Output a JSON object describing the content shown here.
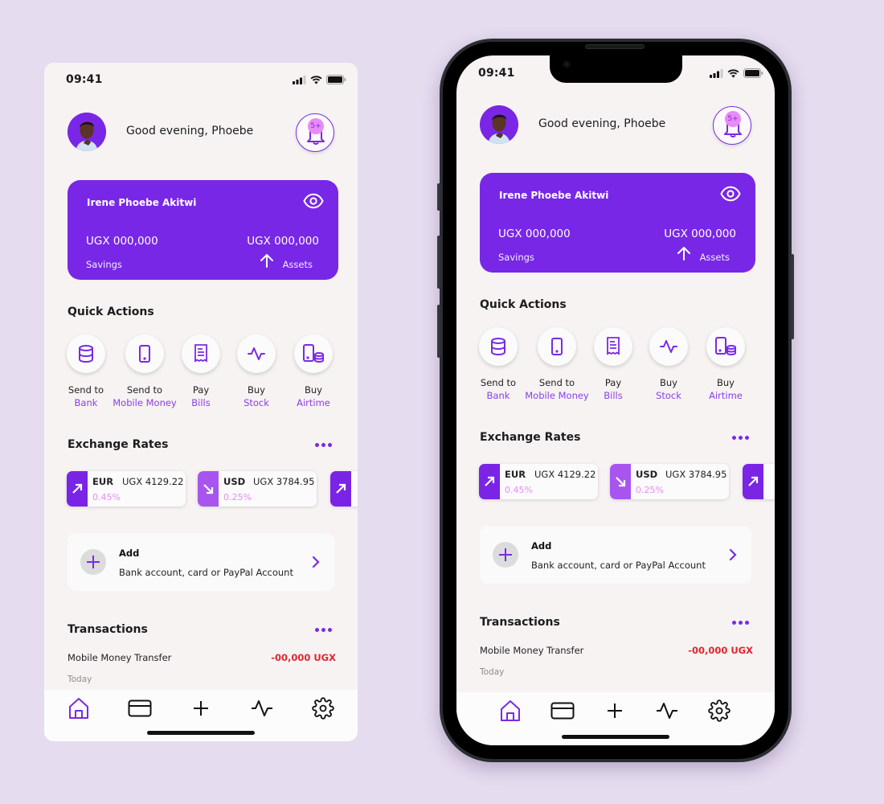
{
  "status_bar": {
    "time": "09:41",
    "icons": [
      "cellular-signal-icon",
      "wifi-icon",
      "battery-icon"
    ]
  },
  "header": {
    "greeting": "Good evening, Phoebe",
    "avatar": "user-avatar",
    "notification_badge": "5+"
  },
  "balance_card": {
    "holder_name": "Irene Phoebe Akitwi",
    "savings_amount": "UGX 000,000",
    "savings_label": "Savings",
    "assets_amount": "UGX 000,000",
    "assets_label": "Assets",
    "icons": [
      "eye-icon",
      "arrow-up-icon"
    ]
  },
  "quick_actions": {
    "title": "Quick Actions",
    "items": [
      {
        "line1": "Send to",
        "line2": "Bank",
        "icon": "database-icon"
      },
      {
        "line1": "Send to",
        "line2": "Mobile Money",
        "icon": "mobile-phone-icon"
      },
      {
        "line1": "Pay",
        "line2": "Bills",
        "icon": "receipt-icon"
      },
      {
        "line1": "Buy",
        "line2": "Stock",
        "icon": "activity-icon"
      },
      {
        "line1": "Buy",
        "line2": "Airtime",
        "icon": "phone-coins-icon"
      }
    ]
  },
  "exchange_rates": {
    "title": "Exchange Rates",
    "items": [
      {
        "code": "EUR",
        "rate": "UGX 4129.22",
        "change": "0.45%",
        "trend": "up",
        "color": "#7a24e6"
      },
      {
        "code": "USD",
        "rate": "UGX 3784.95",
        "change": "0.25%",
        "trend": "down",
        "color": "#a855f0"
      },
      {
        "code": "",
        "rate": "",
        "change": "",
        "trend": "up",
        "color": "#7a24e6"
      }
    ]
  },
  "add_account": {
    "title": "Add",
    "subtitle": "Bank account, card or PayPal Account"
  },
  "transactions": {
    "title": "Transactions",
    "items": [
      {
        "name": "Mobile Money Transfer",
        "amount": "-00,000 UGX",
        "date": "Today"
      }
    ]
  },
  "bottom_nav": {
    "items": [
      {
        "name": "home",
        "active": true
      },
      {
        "name": "cards",
        "active": false
      },
      {
        "name": "add",
        "active": false
      },
      {
        "name": "activity",
        "active": false
      },
      {
        "name": "settings",
        "active": false
      }
    ]
  },
  "colors": {
    "brand": "#7827e6",
    "accent_pink": "#e98bf6",
    "negative": "#e0262e",
    "background": "#e6dcf0",
    "screen": "#f7f3f3"
  }
}
